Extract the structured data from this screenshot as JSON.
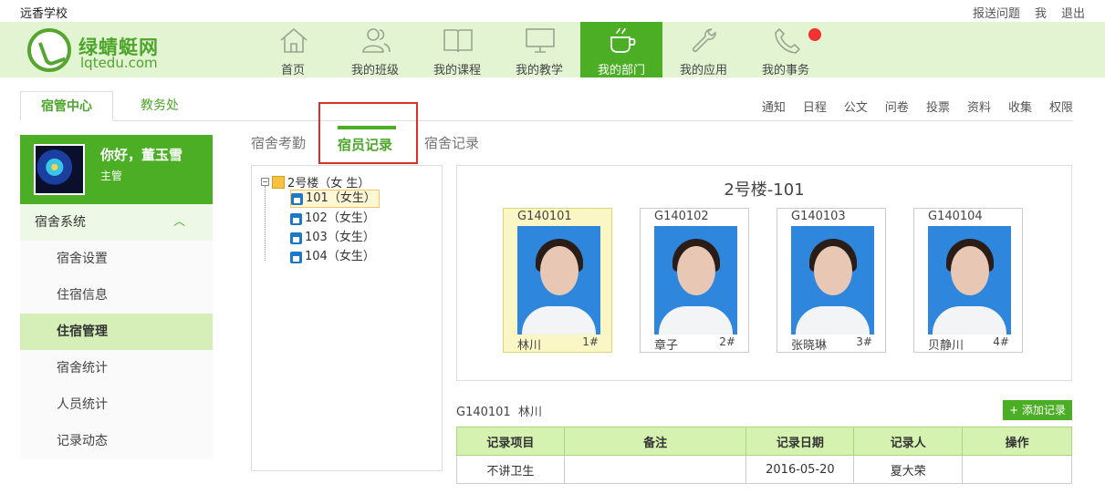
{
  "school_name": "远香学校",
  "top_links": [
    "报送问题",
    "我",
    "退出"
  ],
  "logo": {
    "cn": "绿蜻蜓网",
    "en": "lqtedu.com"
  },
  "nav": [
    {
      "label": "首页",
      "icon": "home-icon"
    },
    {
      "label": "我的班级",
      "icon": "users-icon"
    },
    {
      "label": "我的课程",
      "icon": "book-icon"
    },
    {
      "label": "我的教学",
      "icon": "monitor-icon"
    },
    {
      "label": "我的部门",
      "icon": "cup-icon",
      "active": true
    },
    {
      "label": "我的应用",
      "icon": "wrench-icon"
    },
    {
      "label": "我的事务",
      "icon": "phone-icon",
      "badge": true
    }
  ],
  "main_tabs": {
    "active": "宿管中心",
    "other": "教务处"
  },
  "right_links": [
    "通知",
    "日程",
    "公文",
    "问卷",
    "投票",
    "资料",
    "收集",
    "权限"
  ],
  "user": {
    "greeting": "你好，董玉雪",
    "role": "主管"
  },
  "sidebar": {
    "section": "宿舍系统",
    "items": [
      {
        "label": "宿舍设置"
      },
      {
        "label": "住宿信息"
      },
      {
        "label": "住宿管理",
        "active": true
      },
      {
        "label": "宿舍统计"
      },
      {
        "label": "人员统计"
      },
      {
        "label": "记录动态"
      }
    ]
  },
  "sub_tabs": {
    "left": "宿舍考勤",
    "active": "宿员记录",
    "right": "宿舍记录"
  },
  "tree": {
    "root": "2号楼（女 生）",
    "rooms": [
      "101（女生）",
      "102（女生）",
      "103（女生）",
      "104（女生）"
    ]
  },
  "room": {
    "title": "2号楼-101",
    "students": [
      {
        "id": "G140101",
        "name": "林川",
        "bed": "1#"
      },
      {
        "id": "G140102",
        "name": "章子",
        "bed": "2#"
      },
      {
        "id": "G140103",
        "name": "张晓琳",
        "bed": "3#"
      },
      {
        "id": "G140104",
        "name": "贝静川",
        "bed": "4#"
      }
    ]
  },
  "selected": {
    "id": "G140101",
    "name": "林川"
  },
  "add_button": "+ 添加记录",
  "table": {
    "headers": [
      "记录项目",
      "备注",
      "记录日期",
      "记录人",
      "操作"
    ],
    "rows": [
      [
        "不讲卫生",
        "",
        "2016-05-20",
        "夏大荣",
        ""
      ]
    ]
  },
  "colors": {
    "accent": "#4cae25",
    "nav_bg": "#e3f4d3",
    "badge": "#f23131",
    "highlight_box": "#d9302a"
  }
}
